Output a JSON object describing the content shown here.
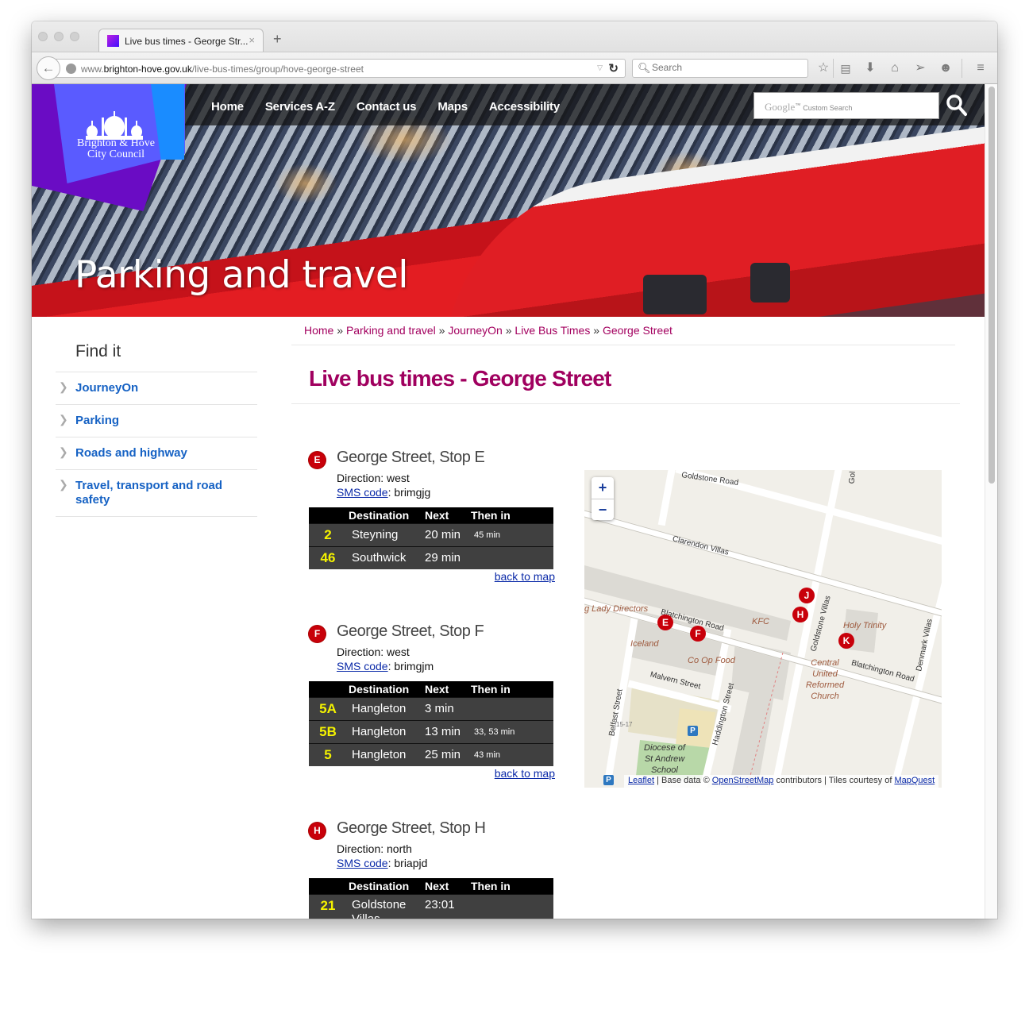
{
  "browser": {
    "tab_title": "Live bus times - George Str...",
    "tab_close": "×",
    "new_tab": "+",
    "back": "←",
    "url_domain_prefix": "www.",
    "url_domain": "brighton-hove.gov.uk",
    "url_path": "/live-bus-times/group/hove-george-street",
    "url_dropdown": "▽",
    "reload": "↻",
    "search_placeholder": "Search",
    "toolbar_icons": [
      "bookmark-star-icon",
      "reading-list-icon",
      "downloads-icon",
      "home-icon",
      "send-icon",
      "chat-icon",
      "menu-icon"
    ]
  },
  "header": {
    "logo_text_line1": "Brighton & Hove",
    "logo_text_line2": "City Council",
    "nav": [
      "Home",
      "Services A-Z",
      "Contact us",
      "Maps",
      "Accessibility"
    ],
    "search_brand": "Google",
    "search_tm": "™",
    "search_placeholder": "Custom Search",
    "hero_title": "Parking and travel"
  },
  "breadcrumb": {
    "items": [
      "Home",
      "Parking and travel",
      "JourneyOn",
      "Live Bus Times",
      "George Street"
    ],
    "separator": "»"
  },
  "page_title": "Live bus times - George Street",
  "sidebar": {
    "title": "Find it",
    "items": [
      {
        "label": "JourneyOn"
      },
      {
        "label": "Parking"
      },
      {
        "label": "Roads and highway"
      },
      {
        "label": "Travel, transport and road safety"
      }
    ]
  },
  "table_headers": {
    "route": "",
    "destination": "Destination",
    "next": "Next",
    "then": "Then in"
  },
  "back_to_map": "back to map",
  "sms_label": "SMS code",
  "stops": [
    {
      "letter": "E",
      "name": "George Street, Stop E",
      "direction": "Direction: west",
      "sms_code": ": brimgjg",
      "rows": [
        {
          "route": "2",
          "destination": "Steyning",
          "next": "20 min",
          "then": "45 min"
        },
        {
          "route": "46",
          "destination": "Southwick",
          "next": "29 min",
          "then": ""
        }
      ]
    },
    {
      "letter": "F",
      "name": "George Street, Stop F",
      "direction": "Direction: west",
      "sms_code": ": brimgjm",
      "rows": [
        {
          "route": "5A",
          "destination": "Hangleton",
          "next": "3 min",
          "then": ""
        },
        {
          "route": "5B",
          "destination": "Hangleton",
          "next": "13 min",
          "then": "33, 53 min"
        },
        {
          "route": "5",
          "destination": "Hangleton",
          "next": "25 min",
          "then": "43 min"
        }
      ]
    },
    {
      "letter": "H",
      "name": "George Street, Stop H",
      "direction": "Direction: north",
      "sms_code": ": briapjd",
      "rows": [
        {
          "route": "21",
          "destination": "Goldstone Villas",
          "next": "23:01",
          "then": ""
        }
      ]
    }
  ],
  "map": {
    "zoom_in": "+",
    "zoom_out": "−",
    "markers": [
      "E",
      "F",
      "H",
      "J",
      "K"
    ],
    "streets": [
      "Goldstone Road",
      "Clarendon Villas",
      "Blatchington Road",
      "Blatchington Road",
      "Goldstone Villas",
      "Malvern Street",
      "Belfast Street",
      "Haddington Street",
      "Denmark Villas",
      "Gol"
    ],
    "pois": [
      "g Lady Directors",
      "Iceland",
      "Co Op Food",
      "KFC",
      "Holy Trinity",
      "Central United Reformed Church",
      "Diocese of St Andrew School",
      "15-17"
    ],
    "parking": "P",
    "attribution": {
      "leaflet": "Leaflet",
      "sep1": " | Base data © ",
      "osm": "OpenStreetMap",
      "mid": " contributors | Tiles courtesy of ",
      "mapquest": "MapQuest"
    }
  }
}
